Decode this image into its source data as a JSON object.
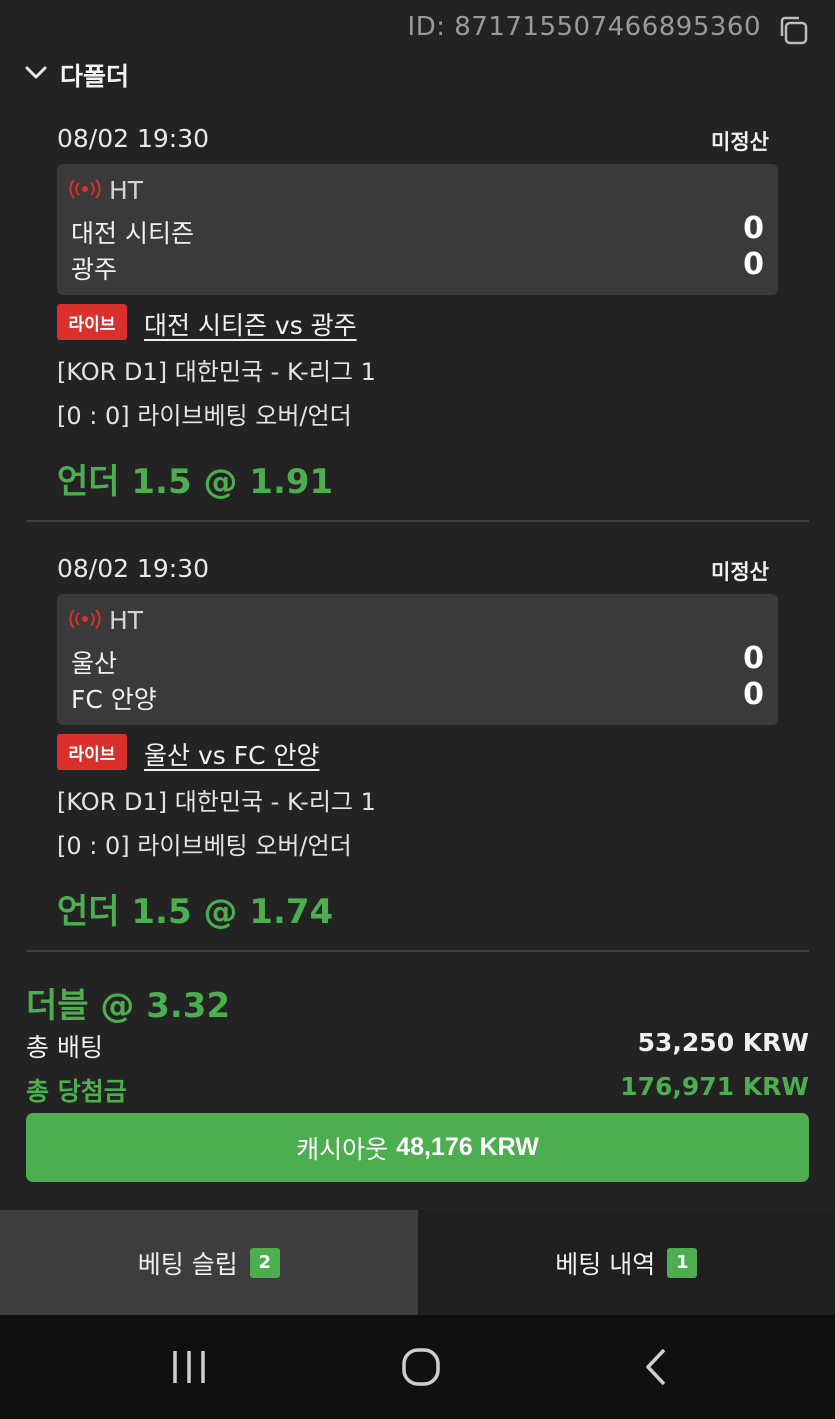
{
  "header": {
    "bet_id": "ID: 8717155074668953​60",
    "copy_icon": "copy-icon"
  },
  "folder": {
    "title": "다폴더",
    "chevron_icon": "chevron-down-icon"
  },
  "matches": [
    {
      "datetime": "08/02 19:30",
      "status": "미정산",
      "period": "HT",
      "home_team": "대전 시티즌",
      "home_score": "0",
      "away_team": "광주",
      "away_score": "0",
      "live_label": "라이브",
      "title": "대전 시티즌 vs 광주",
      "league": "[KOR D1] 대한민국 - K-리그 1",
      "market": "[0 : 0] 라이브베팅 오버/언더",
      "pick": "언더 1.5 @  1.91"
    },
    {
      "datetime": "08/02 19:30",
      "status": "미정산",
      "period": "HT",
      "home_team": "울산",
      "home_score": "0",
      "away_team": "FC 안양",
      "away_score": "0",
      "live_label": "라이브",
      "title": "울산 vs FC 안양",
      "league": "[KOR D1] 대한민국 - K-리그 1",
      "market": "[0 : 0] 라이브베팅 오버/언더",
      "pick": "언더 1.5 @  1.74"
    }
  ],
  "summary": {
    "bet_type": "더블 @  3.32",
    "total_stake_label": "총 배팅",
    "total_stake_value": "53,250 KRW",
    "total_win_label": "총 당첨금",
    "total_win_value": "176,971 KRW"
  },
  "cashout": {
    "label": "캐시아웃",
    "amount": "48,176 KRW"
  },
  "tabs": [
    {
      "label": "베팅 슬립",
      "count": "2"
    },
    {
      "label": "베팅 내역",
      "count": "1"
    }
  ],
  "colors": {
    "accent_green": "#4cae4f",
    "live_red": "#d9302b",
    "background": "#232323",
    "scorebox": "#3a3a3a"
  }
}
